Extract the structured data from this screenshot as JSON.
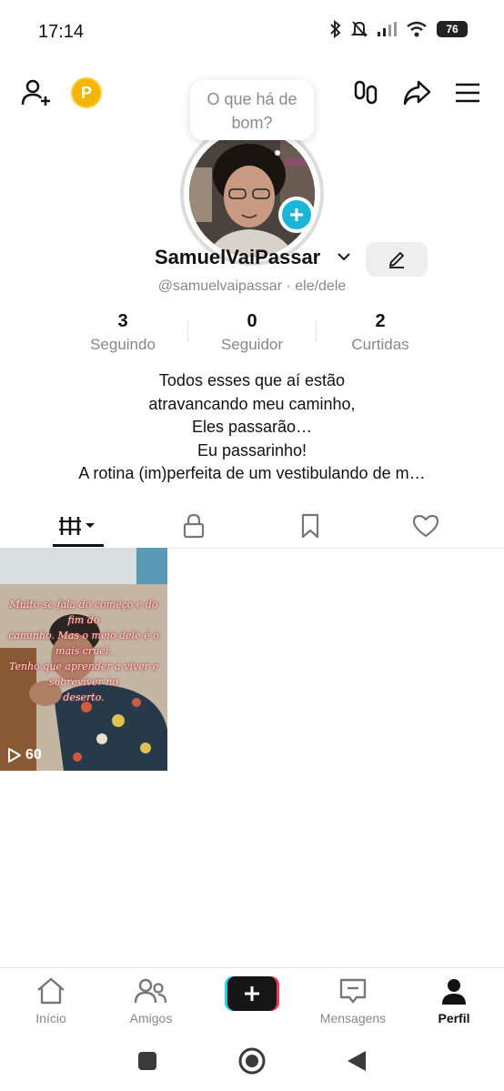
{
  "status_bar": {
    "time": "17:14",
    "battery": "76"
  },
  "header": {
    "coin_letter": "P"
  },
  "profile": {
    "bubble_text_1": "O que há de",
    "bubble_text_2": "bom?",
    "username": "SamuelVaiPassar",
    "handle": "@samuelvaipassar · ele/dele"
  },
  "stats": [
    {
      "value": "3",
      "label": "Seguindo"
    },
    {
      "value": "0",
      "label": "Seguidor"
    },
    {
      "value": "2",
      "label": "Curtidas"
    }
  ],
  "bio": [
    "Todos esses que aí estão",
    "atravancando meu caminho,",
    "Eles passarão…",
    "Eu passarinho!",
    "A rotina (im)perfeita de um vestibulando de m…"
  ],
  "videos": [
    {
      "caption_lines": [
        "Muito se fala do começo e do fim do",
        "caminho. Mas o meio dele é o mais cruel.",
        "Tenho que aprender a viver e sobreviver no",
        "deserto."
      ],
      "views": "60"
    }
  ],
  "bottom_nav": [
    {
      "label": "Início",
      "icon": "home-icon"
    },
    {
      "label": "Amigos",
      "icon": "friends-icon"
    },
    {
      "label": "",
      "icon": "create-icon"
    },
    {
      "label": "Mensagens",
      "icon": "inbox-icon"
    },
    {
      "label": "Perfil",
      "icon": "profile-icon"
    }
  ],
  "colors": {
    "accent": "#19b6d9",
    "coin": "#f5b400",
    "muted": "#888888"
  }
}
